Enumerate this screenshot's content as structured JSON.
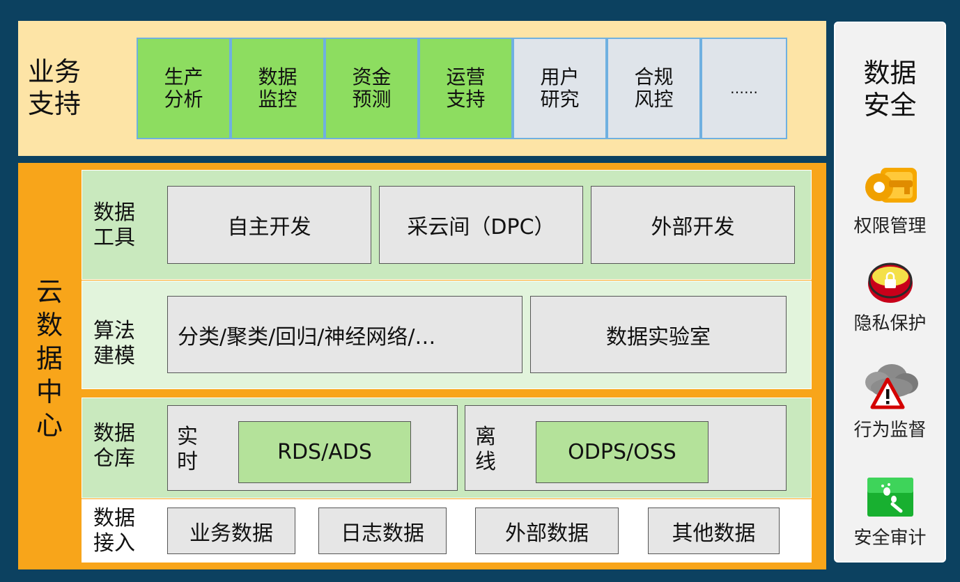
{
  "business": {
    "title_line1": "业务",
    "title_line2": "支持",
    "items": [
      {
        "line1": "生产",
        "line2": "分析",
        "color": "#8ddd60"
      },
      {
        "line1": "数据",
        "line2": "监控",
        "color": "#8ddd60"
      },
      {
        "line1": "资金",
        "line2": "预测",
        "color": "#8ddd60"
      },
      {
        "line1": "运营",
        "line2": "支持",
        "color": "#8ddd60"
      },
      {
        "line1": "用户",
        "line2": "研究",
        "color": "#dfe4ea"
      },
      {
        "line1": "合规",
        "line2": "风控",
        "color": "#dfe4ea"
      },
      {
        "line1": "……",
        "line2": "",
        "color": "#dfe4ea"
      }
    ]
  },
  "datacenter": {
    "title_chars": [
      "云",
      "数",
      "据",
      "中",
      "心"
    ],
    "tools": {
      "label_line1": "数据",
      "label_line2": "工具",
      "items": [
        "自主开发",
        "采云间（DPC）",
        "外部开发"
      ]
    },
    "modeling": {
      "label_line1": "算法",
      "label_line2": "建模",
      "items": [
        "分类/聚类/回归/神经网络/…",
        "数据实验室"
      ]
    },
    "warehouse": {
      "label_line1": "数据",
      "label_line2": "仓库",
      "realtime": {
        "label_line1": "实",
        "label_line2": "时",
        "store": "RDS/ADS"
      },
      "offline": {
        "label_line1": "离",
        "label_line2": "线",
        "store": "ODPS/OSS"
      }
    },
    "ingest": {
      "label_line1": "数据",
      "label_line2": "接入",
      "items": [
        "业务数据",
        "日志数据",
        "外部数据",
        "其他数据"
      ]
    }
  },
  "security": {
    "title_line1": "数据",
    "title_line2": "安全",
    "items": [
      {
        "label": "权限管理",
        "icon": "key-icon"
      },
      {
        "label": "隐私保护",
        "icon": "lock-icon"
      },
      {
        "label": "行为监督",
        "icon": "warning-cloud-icon"
      },
      {
        "label": "安全审计",
        "icon": "footprint-icon"
      }
    ]
  },
  "colors": {
    "background": "#0c4160",
    "business_band": "#fde4a6",
    "datacenter_band": "#f8a51a",
    "green_cell": "#8ddd60",
    "grey_cell": "#dfe4ea",
    "tool_layer": "#c9e9be",
    "model_layer": "#e2f4dc",
    "warehouse_layer": "#c9e9be",
    "store_green": "#b4e29a"
  }
}
